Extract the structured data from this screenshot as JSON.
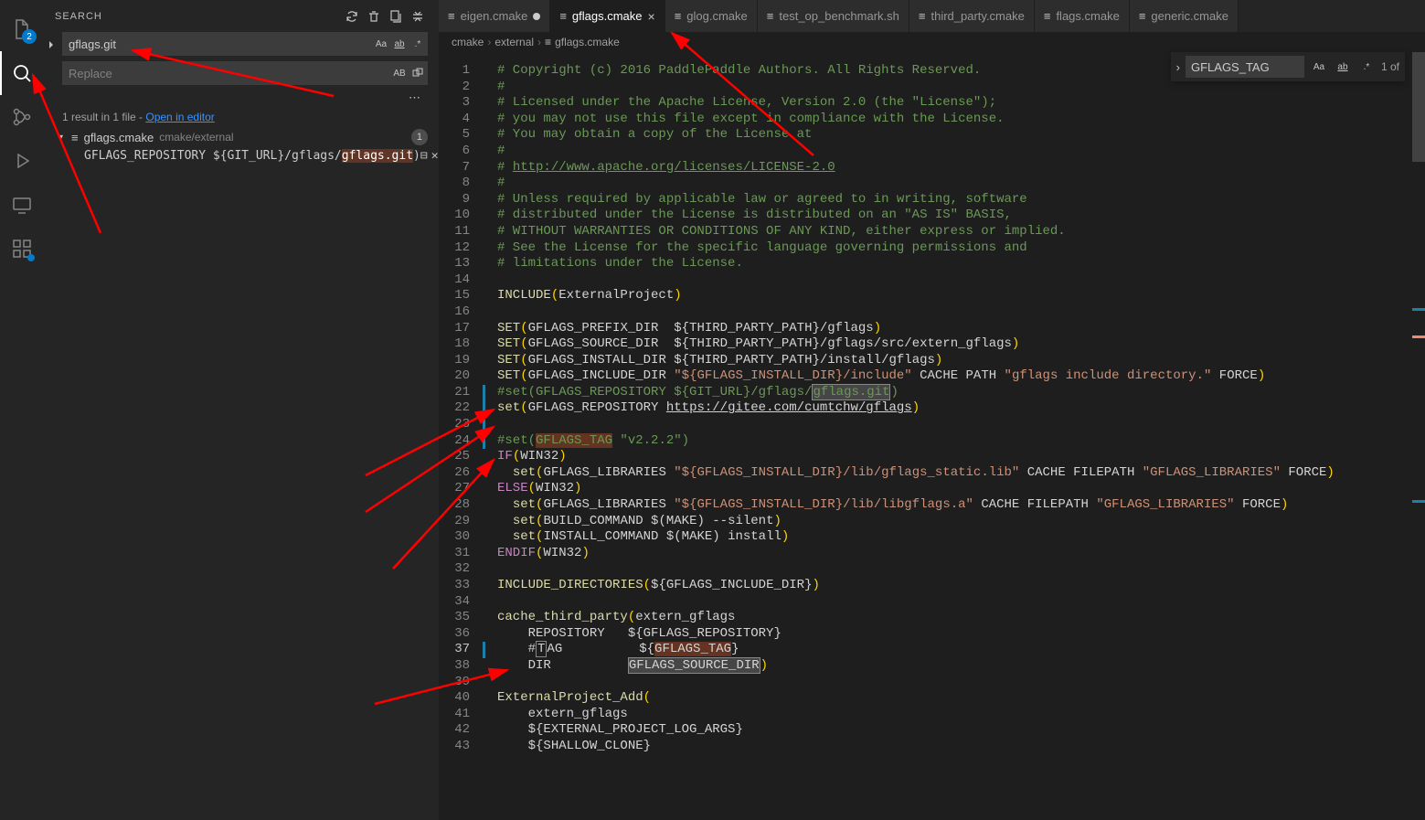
{
  "activity": {
    "explorer_badge": "2"
  },
  "sidebar": {
    "title": "SEARCH",
    "search_value": "gflags.git",
    "replace_placeholder": "Replace",
    "results_text": "1 result in 1 file - ",
    "open_editor": "Open in editor",
    "file_name": "gflags.cmake",
    "file_path": "cmake/external",
    "file_count": "1",
    "line_pre": "GFLAGS_REPOSITORY ${GIT_URL}/gflags/",
    "line_match": "gflags.git",
    "line_post": ")"
  },
  "tabs": [
    {
      "label": "eigen.cmake",
      "modified": true
    },
    {
      "label": "gflags.cmake",
      "active": true,
      "close": true
    },
    {
      "label": "glog.cmake"
    },
    {
      "label": "test_op_benchmark.sh"
    },
    {
      "label": "third_party.cmake"
    },
    {
      "label": "flags.cmake"
    },
    {
      "label": "generic.cmake"
    }
  ],
  "breadcrumb": [
    "cmake",
    "external",
    "gflags.cmake"
  ],
  "find": {
    "value": "GFLAGS_TAG",
    "info": "1 of"
  },
  "code": {
    "lines": [
      {
        "n": 1,
        "t": "comment",
        "text": "# Copyright (c) 2016 PaddlePaddle Authors. All Rights Reserved."
      },
      {
        "n": 2,
        "t": "comment",
        "text": "#"
      },
      {
        "n": 3,
        "t": "comment",
        "text": "# Licensed under the Apache License, Version 2.0 (the \"License\");"
      },
      {
        "n": 4,
        "t": "comment",
        "text": "# you may not use this file except in compliance with the License."
      },
      {
        "n": 5,
        "t": "comment",
        "text": "# You may obtain a copy of the License at"
      },
      {
        "n": 6,
        "t": "comment",
        "text": "#"
      },
      {
        "n": 7,
        "t": "link",
        "text": "# ",
        "link": "http://www.apache.org/licenses/LICENSE-2.0"
      },
      {
        "n": 8,
        "t": "comment",
        "text": "#"
      },
      {
        "n": 9,
        "t": "comment",
        "text": "# Unless required by applicable law or agreed to in writing, software"
      },
      {
        "n": 10,
        "t": "comment",
        "text": "# distributed under the License is distributed on an \"AS IS\" BASIS,"
      },
      {
        "n": 11,
        "t": "comment",
        "text": "# WITHOUT WARRANTIES OR CONDITIONS OF ANY KIND, either express or implied."
      },
      {
        "n": 12,
        "t": "comment",
        "text": "# See the License for the specific language governing permissions and"
      },
      {
        "n": 13,
        "t": "comment",
        "text": "# limitations under the License."
      },
      {
        "n": 14,
        "t": "blank",
        "text": ""
      },
      {
        "n": 15,
        "t": "call",
        "func": "INCLUDE",
        "args": "ExternalProject"
      },
      {
        "n": 16,
        "t": "blank",
        "text": ""
      },
      {
        "n": 17,
        "t": "set",
        "func": "SET",
        "args": "GFLAGS_PREFIX_DIR  ${THIRD_PARTY_PATH}/gflags"
      },
      {
        "n": 18,
        "t": "set",
        "func": "SET",
        "args": "GFLAGS_SOURCE_DIR  ${THIRD_PARTY_PATH}/gflags/src/extern_gflags"
      },
      {
        "n": 19,
        "t": "set",
        "func": "SET",
        "args": "GFLAGS_INSTALL_DIR ${THIRD_PARTY_PATH}/install/gflags"
      },
      {
        "n": 20,
        "t": "setstr",
        "func": "SET",
        "raw": "GFLAGS_INCLUDE_DIR \"${GFLAGS_INSTALL_DIR}/include\" CACHE PATH \"gflags include directory.\" FORCE"
      },
      {
        "n": 21,
        "t": "chl",
        "text": "#set(GFLAGS_REPOSITORY ${GIT_URL}/gflags/",
        "hl": "gflags.git",
        "post": ")",
        "mark": true
      },
      {
        "n": 22,
        "t": "setlink",
        "func": "set",
        "args": "GFLAGS_REPOSITORY ",
        "link": "https://gitee.com/cumtchw/gflags",
        "mark": true
      },
      {
        "n": 23,
        "t": "blank",
        "text": "",
        "mark": true
      },
      {
        "n": 24,
        "t": "ctag",
        "text": "#set(",
        "hl": "GFLAGS_TAG",
        "post": " \"v2.2.2\")",
        "mark": true
      },
      {
        "n": 25,
        "t": "if",
        "func": "IF",
        "args": "WIN32"
      },
      {
        "n": 26,
        "t": "setstr2",
        "func": "set",
        "indent": "  ",
        "raw": "GFLAGS_LIBRARIES \"${GFLAGS_INSTALL_DIR}/lib/gflags_static.lib\" CACHE FILEPATH \"GFLAGS_LIBRARIES\" FORCE"
      },
      {
        "n": 27,
        "t": "else",
        "func": "ELSE",
        "args": "WIN32"
      },
      {
        "n": 28,
        "t": "setstr2",
        "func": "set",
        "indent": "  ",
        "raw": "GFLAGS_LIBRARIES \"${GFLAGS_INSTALL_DIR}/lib/libgflags.a\" CACHE FILEPATH \"GFLAGS_LIBRARIES\" FORCE"
      },
      {
        "n": 29,
        "t": "set2",
        "func": "set",
        "indent": "  ",
        "args": "BUILD_COMMAND $(MAKE) --silent"
      },
      {
        "n": 30,
        "t": "set2",
        "func": "set",
        "indent": "  ",
        "args": "INSTALL_COMMAND $(MAKE) install"
      },
      {
        "n": 31,
        "t": "endif",
        "func": "ENDIF",
        "args": "WIN32"
      },
      {
        "n": 32,
        "t": "blank",
        "text": ""
      },
      {
        "n": 33,
        "t": "call2",
        "func": "INCLUDE_DIRECTORIES",
        "args": "${GFLAGS_INCLUDE_DIR}"
      },
      {
        "n": 34,
        "t": "blank",
        "text": ""
      },
      {
        "n": 35,
        "t": "callopen",
        "func": "cache_third_party",
        "args": "extern_gflags"
      },
      {
        "n": 36,
        "t": "kv",
        "indent": "    ",
        "key": "REPOSITORY",
        "val": "${GFLAGS_REPOSITORY}"
      },
      {
        "n": 37,
        "t": "tagline",
        "indent": "    #",
        "key": "TAG",
        "val": "${",
        "hl": "GFLAGS_TAG",
        "post": "}",
        "mark": true,
        "curr": true
      },
      {
        "n": 38,
        "t": "kvclose",
        "indent": "    ",
        "key": "DIR",
        "val": "GFLAGS_SOURCE_DIR"
      },
      {
        "n": 39,
        "t": "blank",
        "text": ""
      },
      {
        "n": 40,
        "t": "callopen2",
        "func": "ExternalProject_Add"
      },
      {
        "n": 41,
        "t": "arg",
        "indent": "    ",
        "text": "extern_gflags"
      },
      {
        "n": 42,
        "t": "arg",
        "indent": "    ",
        "text": "${EXTERNAL_PROJECT_LOG_ARGS}"
      },
      {
        "n": 43,
        "t": "arg",
        "indent": "    ",
        "text": "${SHALLOW_CLONE}"
      }
    ]
  }
}
